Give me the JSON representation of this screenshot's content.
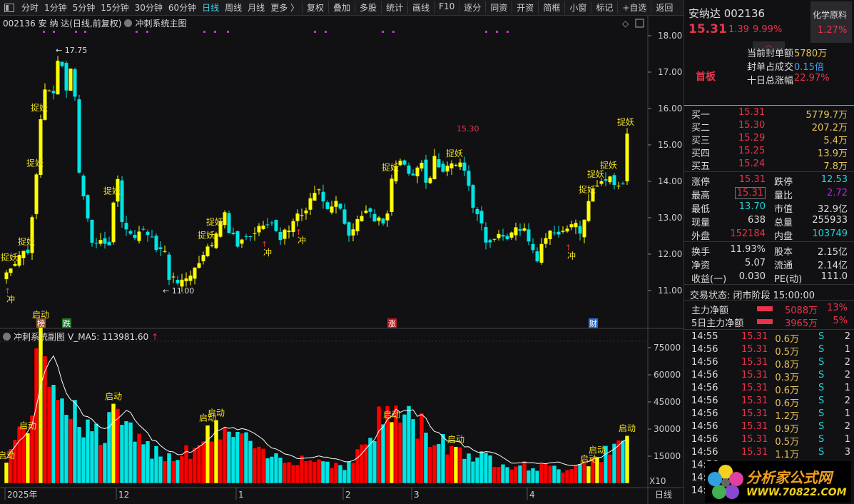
{
  "toolbar": {
    "periods": [
      "分时",
      "1分钟",
      "5分钟",
      "15分钟",
      "30分钟",
      "60分钟",
      "日线",
      "周线",
      "月线",
      "更多 〉"
    ],
    "active": "日线",
    "tools": [
      "复权",
      "叠加",
      "多股",
      "统计",
      "画线",
      "F10",
      "逐分",
      "同资",
      "开资",
      "简框",
      "小窗",
      "标记",
      "+自选",
      "返回"
    ]
  },
  "main": {
    "title": "002136 安 纳 达(日线,前复权)",
    "indicator": "冲刺系统主图",
    "price_ticks": [
      "18.00",
      "17.00",
      "16.00",
      "15.00",
      "14.00",
      "13.00",
      "12.00",
      "11.00"
    ],
    "high_label": "17.75",
    "low_label": "11.00",
    "peak_label": "15.30",
    "signal_text": "捉妖",
    "rush_text": "冲",
    "events": [
      {
        "i": 8,
        "t": "榜",
        "c": "#a0522d"
      },
      {
        "i": 14,
        "t": "跌",
        "c": "#1b7a2a"
      },
      {
        "i": 90,
        "t": "涨",
        "c": "#c0151c"
      },
      {
        "i": 137,
        "t": "财",
        "c": "#2a6fd0"
      }
    ]
  },
  "sub": {
    "title": "冲刺系统副图",
    "ma_label": "V_MA5: 113981.60",
    "vol_ticks": [
      "75000",
      "60000",
      "45000",
      "30000",
      "15000"
    ],
    "unit": "X10",
    "start_text": "启动"
  },
  "xaxis": {
    "labels": [
      {
        "i": 0,
        "t": "2025年"
      },
      {
        "i": 26,
        "t": "12"
      },
      {
        "i": 54,
        "t": "1"
      },
      {
        "i": 79,
        "t": "2"
      },
      {
        "i": 95,
        "t": "3"
      },
      {
        "i": 122,
        "t": "4"
      }
    ],
    "period": "日线"
  },
  "chart_data": {
    "type": "candlestick",
    "count": 146,
    "price_range": [
      11,
      18
    ],
    "volume_range": [
      0,
      75000
    ],
    "close_anchors": [
      [
        0,
        11.5
      ],
      [
        3,
        12.0
      ],
      [
        5,
        12.1
      ],
      [
        6,
        13
      ],
      [
        7,
        14.3
      ],
      [
        8,
        15.8
      ],
      [
        9,
        16.6
      ],
      [
        11,
        16.3
      ],
      [
        12,
        17.3
      ],
      [
        13,
        17.1
      ],
      [
        14,
        16.6
      ],
      [
        15,
        17.0
      ],
      [
        16,
        16.3
      ],
      [
        17,
        14.2
      ],
      [
        18,
        13.6
      ],
      [
        19,
        13.0
      ],
      [
        20,
        12.2
      ],
      [
        22,
        12.4
      ],
      [
        24,
        12.3
      ],
      [
        25,
        13.3
      ],
      [
        26,
        14.0
      ],
      [
        27,
        13.0
      ],
      [
        29,
        12.5
      ],
      [
        32,
        12.7
      ],
      [
        35,
        12.2
      ],
      [
        37,
        12.0
      ],
      [
        38,
        11.4
      ],
      [
        40,
        11.2
      ],
      [
        42,
        11.4
      ],
      [
        44,
        11.6
      ],
      [
        46,
        12.1
      ],
      [
        48,
        12.2
      ],
      [
        50,
        13.0
      ],
      [
        51,
        13.2
      ],
      [
        52,
        12.6
      ],
      [
        54,
        12.3
      ],
      [
        56,
        12.5
      ],
      [
        58,
        12.5
      ],
      [
        60,
        12.8
      ],
      [
        62,
        12.8
      ],
      [
        64,
        12.5
      ],
      [
        66,
        12.6
      ],
      [
        67,
        12.9
      ],
      [
        69,
        13.1
      ],
      [
        72,
        13.6
      ],
      [
        73,
        13.8
      ],
      [
        75,
        13.3
      ],
      [
        77,
        13.4
      ],
      [
        79,
        12.9
      ],
      [
        80,
        12.6
      ],
      [
        82,
        13.0
      ],
      [
        84,
        13.1
      ],
      [
        86,
        13.0
      ],
      [
        88,
        12.9
      ],
      [
        89,
        13.2
      ],
      [
        90,
        14.0
      ],
      [
        91,
        14.4
      ],
      [
        93,
        14.5
      ],
      [
        95,
        14.1
      ],
      [
        97,
        14.6
      ],
      [
        98,
        13.9
      ],
      [
        99,
        14.0
      ],
      [
        100,
        14.6
      ],
      [
        102,
        14.3
      ],
      [
        104,
        14.5
      ],
      [
        106,
        14.5
      ],
      [
        108,
        14.0
      ],
      [
        109,
        13.4
      ],
      [
        110,
        13.2
      ],
      [
        112,
        12.4
      ],
      [
        113,
        12.2
      ],
      [
        115,
        12.6
      ],
      [
        117,
        12.3
      ],
      [
        119,
        12.8
      ],
      [
        121,
        12.7
      ],
      [
        123,
        12.2
      ],
      [
        124,
        11.9
      ],
      [
        125,
        12.3
      ],
      [
        127,
        12.6
      ],
      [
        129,
        12.6
      ],
      [
        131,
        12.7
      ],
      [
        133,
        12.8
      ],
      [
        134,
        12.5
      ],
      [
        135,
        13.0
      ],
      [
        136,
        13.4
      ],
      [
        137,
        13.8
      ],
      [
        138,
        14.0
      ],
      [
        140,
        13.9
      ],
      [
        141,
        14.2
      ],
      [
        142,
        13.8
      ],
      [
        144,
        14.0
      ],
      [
        145,
        15.31
      ]
    ],
    "volume_anchors": [
      [
        0,
        15000
      ],
      [
        5,
        35000
      ],
      [
        8,
        70000
      ],
      [
        11,
        65000
      ],
      [
        14,
        45000
      ],
      [
        18,
        35000
      ],
      [
        22,
        25000
      ],
      [
        26,
        40000
      ],
      [
        30,
        22000
      ],
      [
        40,
        15000
      ],
      [
        50,
        30000
      ],
      [
        55,
        25000
      ],
      [
        60,
        15000
      ],
      [
        70,
        14000
      ],
      [
        80,
        10000
      ],
      [
        89,
        40000
      ],
      [
        95,
        35000
      ],
      [
        100,
        25000
      ],
      [
        110,
        15000
      ],
      [
        120,
        10000
      ],
      [
        130,
        8000
      ],
      [
        138,
        15000
      ],
      [
        142,
        18000
      ],
      [
        145,
        25000
      ]
    ],
    "signal_idx": [
      1,
      5,
      7,
      8,
      25,
      49,
      47,
      90,
      105,
      136,
      138,
      141,
      145
    ],
    "rush_idx": [
      0,
      60,
      68,
      131
    ],
    "start_idx": [
      0,
      5,
      8,
      25,
      49,
      47,
      90,
      105,
      136,
      138,
      145
    ]
  },
  "quote": {
    "name_code": "安纳达 002136",
    "sector": "化学原料",
    "sector_pct": "1.27%",
    "price": "15.31",
    "change": "1.39",
    "pct": "9.99%",
    "board": "首板",
    "seal": [
      {
        "k": "当前封单额",
        "v": "5780万",
        "c": "yel"
      },
      {
        "k": "封单占成交",
        "v": "0.15倍",
        "c": "blue"
      },
      {
        "k": "十日总涨幅",
        "v": "22.97%",
        "c": "red"
      }
    ],
    "bids": [
      {
        "k": "买一",
        "p": "15.31",
        "v": "5779.7万"
      },
      {
        "k": "买二",
        "p": "15.30",
        "v": "207.2万"
      },
      {
        "k": "买三",
        "p": "15.29",
        "v": "5.4万"
      },
      {
        "k": "买四",
        "p": "15.25",
        "v": "13.9万"
      },
      {
        "k": "买五",
        "p": "15.24",
        "v": "7.8万"
      }
    ],
    "stats": [
      [
        {
          "k": "涨停",
          "v": "15.31",
          "c": "red"
        },
        {
          "k": "跌停",
          "v": "12.53",
          "c": "cyan"
        }
      ],
      [
        {
          "k": "最高",
          "v": "15.31",
          "c": "red"
        },
        {
          "k": "量比",
          "v": "2.72",
          "c": "pur"
        }
      ],
      [
        {
          "k": "最低",
          "v": "13.70",
          "c": "cyan"
        },
        {
          "k": "市值",
          "v": "32.9亿",
          "c": "wh"
        }
      ],
      [
        {
          "k": "现量",
          "v": "638",
          "c": "wh"
        },
        {
          "k": "总量",
          "v": "255933",
          "c": "wh"
        }
      ],
      [
        {
          "k": "外盘",
          "v": "152184",
          "c": "red"
        },
        {
          "k": "内盘",
          "v": "103749",
          "c": "cyan"
        }
      ]
    ],
    "stats2": [
      [
        {
          "k": "换手",
          "v": "11.93%"
        },
        {
          "k": "股本",
          "v": "2.15亿"
        }
      ],
      [
        {
          "k": "净资",
          "v": "5.07"
        },
        {
          "k": "流通",
          "v": "2.14亿"
        }
      ],
      [
        {
          "k": "收益(一)",
          "v": "0.030"
        },
        {
          "k": "PE(动)",
          "v": "111.0"
        }
      ]
    ],
    "status": "交易状态: 闭市阶段 15:00:00",
    "flows": [
      {
        "k": "主力净额",
        "v": "5088万",
        "p": "13%"
      },
      {
        "k": "5日主力净额",
        "v": "3965万",
        "p": "5%"
      }
    ],
    "ticks": [
      [
        "14:55",
        "15.31",
        "0.6万",
        "S",
        "2"
      ],
      [
        "14:56",
        "15.31",
        "0.5万",
        "S",
        "1"
      ],
      [
        "14:56",
        "15.31",
        "0.8万",
        "S",
        "2"
      ],
      [
        "14:56",
        "15.31",
        "0.3万",
        "S",
        "2"
      ],
      [
        "14:56",
        "15.31",
        "0.6万",
        "S",
        "1"
      ],
      [
        "14:56",
        "15.31",
        "0.6万",
        "S",
        "2"
      ],
      [
        "14:56",
        "15.31",
        "1.2万",
        "S",
        "1"
      ],
      [
        "14:56",
        "15.31",
        "0.9万",
        "S",
        "2"
      ],
      [
        "14:56",
        "15.31",
        "0.5万",
        "S",
        "1"
      ],
      [
        "14:56",
        "15.31",
        "1.1万",
        "S",
        "3"
      ],
      [
        "14:56",
        "",
        "",
        "",
        ""
      ],
      [
        "14:56",
        "",
        "",
        "",
        ""
      ],
      [
        "14:56",
        "",
        "",
        "",
        ""
      ]
    ]
  },
  "logo": {
    "text": "分析家公式网",
    "url": "WWW.70822.COM"
  },
  "colors": {
    "up": "#ffff00",
    "down": "#00e5e5",
    "vol_up": "#ff0000",
    "red": "#e8334a"
  }
}
